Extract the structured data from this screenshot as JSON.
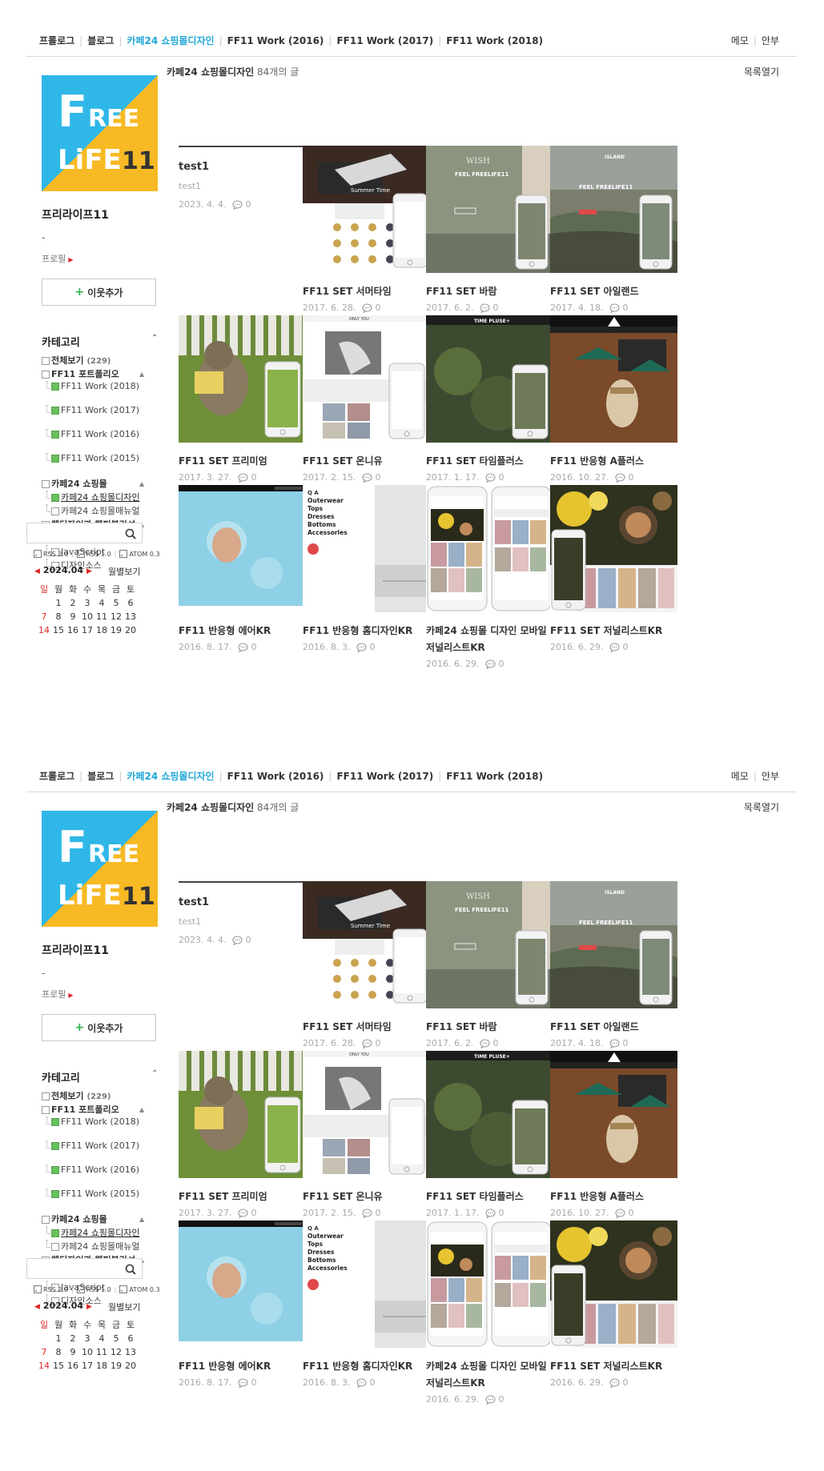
{
  "nav": {
    "links": [
      "프롤로그",
      "블로그",
      "카페24 쇼핑몰디자인",
      "FF11 Work (2016)",
      "FF11 Work (2017)",
      "FF11 Work (2018)"
    ],
    "active_index": 2,
    "right": [
      "메모",
      "안부"
    ]
  },
  "sidebar": {
    "logo_text": [
      "F",
      "REE",
      "LiFE",
      "11"
    ],
    "blog_name": "프리라이프11",
    "description": "-",
    "profile_link": "프로필",
    "add_friend": "이웃추가",
    "category_title": "카테고리",
    "categories": [
      {
        "label": "전체보기",
        "count": "(229)",
        "level": 0
      },
      {
        "label": "FF11 포트폴리오",
        "level": 0,
        "caret": true
      },
      {
        "label": "FF11 Work (2018)",
        "level": 1,
        "icon": "green"
      },
      {
        "label": "FF11 Work (2017)",
        "level": 1,
        "icon": "green"
      },
      {
        "label": "FF11 Work (2016)",
        "level": 1,
        "icon": "green"
      },
      {
        "label": "FF11 Work (2015)",
        "level": 1,
        "icon": "green"
      },
      {
        "label": "카페24 쇼핑몰",
        "level": 0,
        "caret": true
      },
      {
        "label": "카페24 쇼핑몰디자인",
        "level": 1,
        "icon": "green",
        "active": true
      },
      {
        "label": "카페24 쇼핑몰매뉴얼",
        "level": 1
      },
      {
        "label": "웹디자인과 웹퍼블리셔",
        "level": 0,
        "caret": true
      },
      {
        "label": "jQuery",
        "level": 1
      },
      {
        "label": "JavaScript",
        "level": 1
      },
      {
        "label": "디자인소스",
        "level": 1
      }
    ],
    "search_placeholder": "",
    "rss": [
      "RSS 2.0",
      "RSS 1.0",
      "ATOM 0.3"
    ],
    "calendar": {
      "month": "2024.04",
      "monthly_view": "월별보기",
      "weekdays": [
        "일",
        "월",
        "화",
        "수",
        "목",
        "금",
        "토"
      ],
      "weeks": [
        [
          "",
          "1",
          "2",
          "3",
          "4",
          "5",
          "6"
        ],
        [
          "7",
          "8",
          "9",
          "10",
          "11",
          "12",
          "13"
        ],
        [
          "14",
          "15",
          "16",
          "17",
          "18",
          "19",
          "20"
        ]
      ]
    }
  },
  "main": {
    "category_name": "카페24 쇼핑몰디자인",
    "post_count": "84개의 글",
    "list_open": "목록열기",
    "text_post": {
      "title": "test1",
      "excerpt": "test1",
      "date": "2023. 4. 4.",
      "comments": "0"
    },
    "posts": [
      {
        "title": "FF11 SET 서머타임",
        "date": "2017. 6. 28.",
        "comments": "0",
        "thumb": "summer"
      },
      {
        "title": "FF11 SET 바람",
        "date": "2017. 6. 2.",
        "comments": "0",
        "thumb": "wind"
      },
      {
        "title": "FF11 SET 아일랜드",
        "date": "2017. 4. 18.",
        "comments": "0",
        "thumb": "island"
      },
      {
        "title": "FF11 SET 프리미엄",
        "date": "2017. 3. 27.",
        "comments": "0",
        "thumb": "cat"
      },
      {
        "title": "FF11 SET 온니유",
        "date": "2017. 2. 15.",
        "comments": "0",
        "thumb": "onlyyou"
      },
      {
        "title": "FF11 SET 타임플러스",
        "date": "2017. 1. 17.",
        "comments": "0",
        "thumb": "timeplus"
      },
      {
        "title": "FF11 반응형 A플러스",
        "date": "2016. 10. 27.",
        "comments": "0",
        "thumb": "cafe"
      },
      {
        "title": "FF11 반응형 에어KR",
        "date": "2016. 8. 17.",
        "comments": "0",
        "thumb": "water"
      },
      {
        "title": "FF11 반응형 홈디자인KR",
        "date": "2016. 8. 3.",
        "comments": "0",
        "thumb": "homedesign"
      },
      {
        "title": "카페24 쇼핑몰 디자인 모바일 저널리스트KR",
        "date": "2016. 6. 29.",
        "comments": "0",
        "thumb": "journalist"
      },
      {
        "title": "FF11 SET 저널리스트KR",
        "date": "2016. 6. 29.",
        "comments": "0",
        "thumb": "journalist2"
      }
    ],
    "thumb_text": {
      "summer": "Summer Time",
      "wind_brand": "WISH",
      "wind_headline": "FEEL FREELIFE11",
      "island_brand": "ISLAND",
      "island_headline": "FEEL FREELIFE11",
      "onlyyou_brand": "ONLY YOU",
      "timeplus_brand": "TIME PLUSE+",
      "home_menu": [
        "Outerwear",
        "Tops",
        "Dresses",
        "Bottoms",
        "Accessories"
      ]
    }
  },
  "colors": {
    "accent": "#22a8d8",
    "logo_blue": "#2fb7e8",
    "logo_yellow": "#f7b924",
    "red": "#e02828",
    "green": "#66c15a"
  }
}
